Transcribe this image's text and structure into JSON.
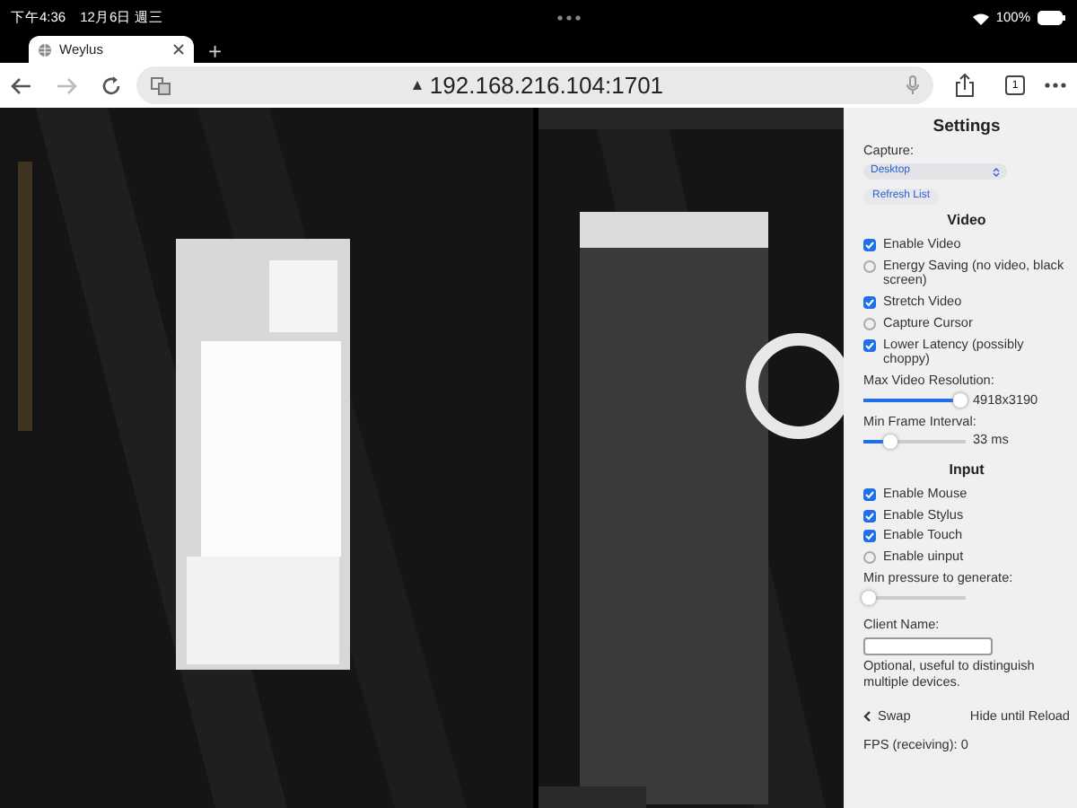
{
  "status_bar": {
    "time": "下午4:36",
    "date": "12月6日 週三",
    "battery": "100%"
  },
  "tabs": [
    {
      "title": "Weylus",
      "selected": true
    }
  ],
  "new_tab": "+",
  "address_bar": {
    "url": "192.168.216.104:1701"
  },
  "tab_count": "1",
  "settings": {
    "title": "Settings",
    "capture_label": "Capture:",
    "capture_value": "Desktop",
    "refresh_button": "Refresh List",
    "video_heading": "Video",
    "video_options": [
      {
        "label": "Enable Video",
        "checked": true
      },
      {
        "label": "Energy Saving (no video, black screen)",
        "checked": false
      },
      {
        "label": "Stretch Video",
        "checked": true
      },
      {
        "label": "Capture Cursor",
        "checked": false
      },
      {
        "label": "Lower Latency (possibly choppy)",
        "checked": true
      }
    ],
    "sliders": [
      {
        "label": "Max Video Resolution:",
        "level": 0.95,
        "reading": "4918x3190"
      },
      {
        "label": "Min Frame Interval:",
        "level": 0.27,
        "reading": "33 ms"
      }
    ],
    "input_heading": "Input",
    "input_options": [
      {
        "label": "Enable Mouse",
        "checked": true
      },
      {
        "label": "Enable Stylus",
        "checked": true
      },
      {
        "label": "Enable Touch",
        "checked": true
      },
      {
        "label": "Enable uinput",
        "checked": false
      }
    ],
    "pressure": {
      "label": "Min pressure to generate:",
      "level": 0.05
    },
    "client_name_label": "Client Name:",
    "client_name_help": "Optional, useful to distinguish multiple devices.",
    "swap": "Swap",
    "hide": "Hide until Reload",
    "fps": "FPS (receiving): 0"
  }
}
